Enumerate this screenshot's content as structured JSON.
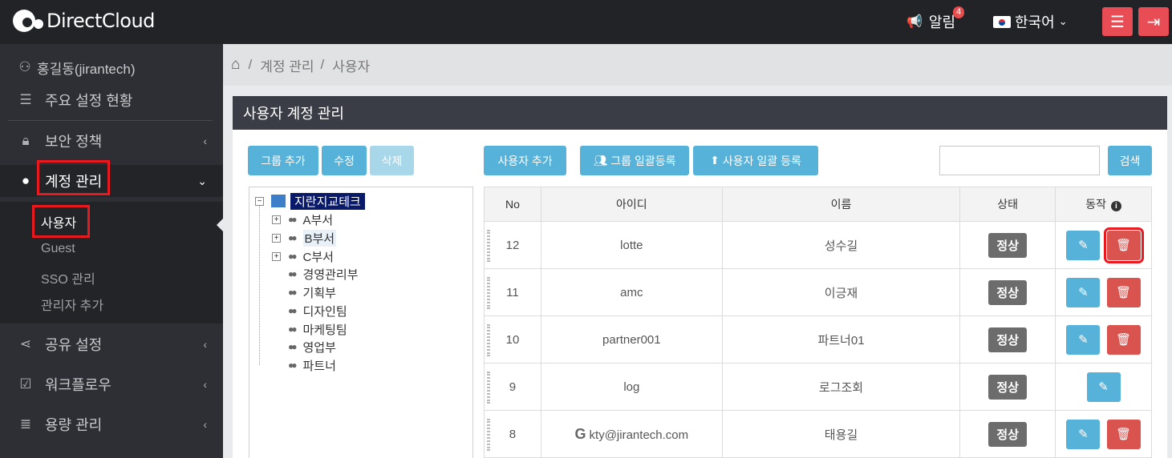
{
  "app": {
    "logo_text": "DirectCloud"
  },
  "topbar": {
    "notice_label": "알림",
    "notice_count": "4",
    "language": "한국어"
  },
  "sidebar": {
    "user": "홍길동(jirantech)",
    "items": [
      {
        "label": "주요 설정 현황",
        "icon": "list-icon"
      },
      {
        "label": "보안 정책",
        "icon": "lock-icon"
      },
      {
        "label": "계정 관리",
        "icon": "user-circle-icon"
      },
      {
        "label": "공유 설정",
        "icon": "share-icon"
      },
      {
        "label": "워크플로우",
        "icon": "checkbox-icon"
      },
      {
        "label": "용량 관리",
        "icon": "database-icon"
      }
    ],
    "subitems": [
      "사용자",
      "Guest",
      "SSO 관리",
      "관리자 추가"
    ]
  },
  "breadcrumb": {
    "level1": "계정 관리",
    "level2": "사용자"
  },
  "panel": {
    "title": "사용자 계정 관리",
    "group_add": "그룹 추가",
    "edit": "수정",
    "delete": "삭제",
    "user_add": "사용자 추가",
    "group_bulk": "그룹 일괄등록",
    "user_bulk": "사용자 일괄 등록",
    "search": "검색"
  },
  "tree": {
    "root": "지란지교테크",
    "nodes": [
      "A부서",
      "B부서",
      "C부서",
      "경영관리부",
      "기획부",
      "디자인팀",
      "마케팅팀",
      "영업부",
      "파트너"
    ]
  },
  "table": {
    "headers": [
      "No",
      "아이디",
      "이름",
      "상태",
      "동작"
    ],
    "rows": [
      {
        "no": "12",
        "id": "lotte",
        "name": "성수길",
        "status": "정상",
        "deletable": true
      },
      {
        "no": "11",
        "id": "amc",
        "name": "이긍재",
        "status": "정상",
        "deletable": true
      },
      {
        "no": "10",
        "id": "partner001",
        "name": "파트너01",
        "status": "정상",
        "deletable": true
      },
      {
        "no": "9",
        "id": "log",
        "name": "로그조회",
        "status": "정상",
        "deletable": false
      },
      {
        "no": "8",
        "id": "kty@jirantech.com",
        "name": "태용길",
        "status": "정상",
        "deletable": true
      }
    ]
  },
  "colors": {
    "accent": "#56b2d8",
    "danger": "#d9534f",
    "topbar_btn": "#e84c55",
    "highlight": "#e8191f"
  }
}
